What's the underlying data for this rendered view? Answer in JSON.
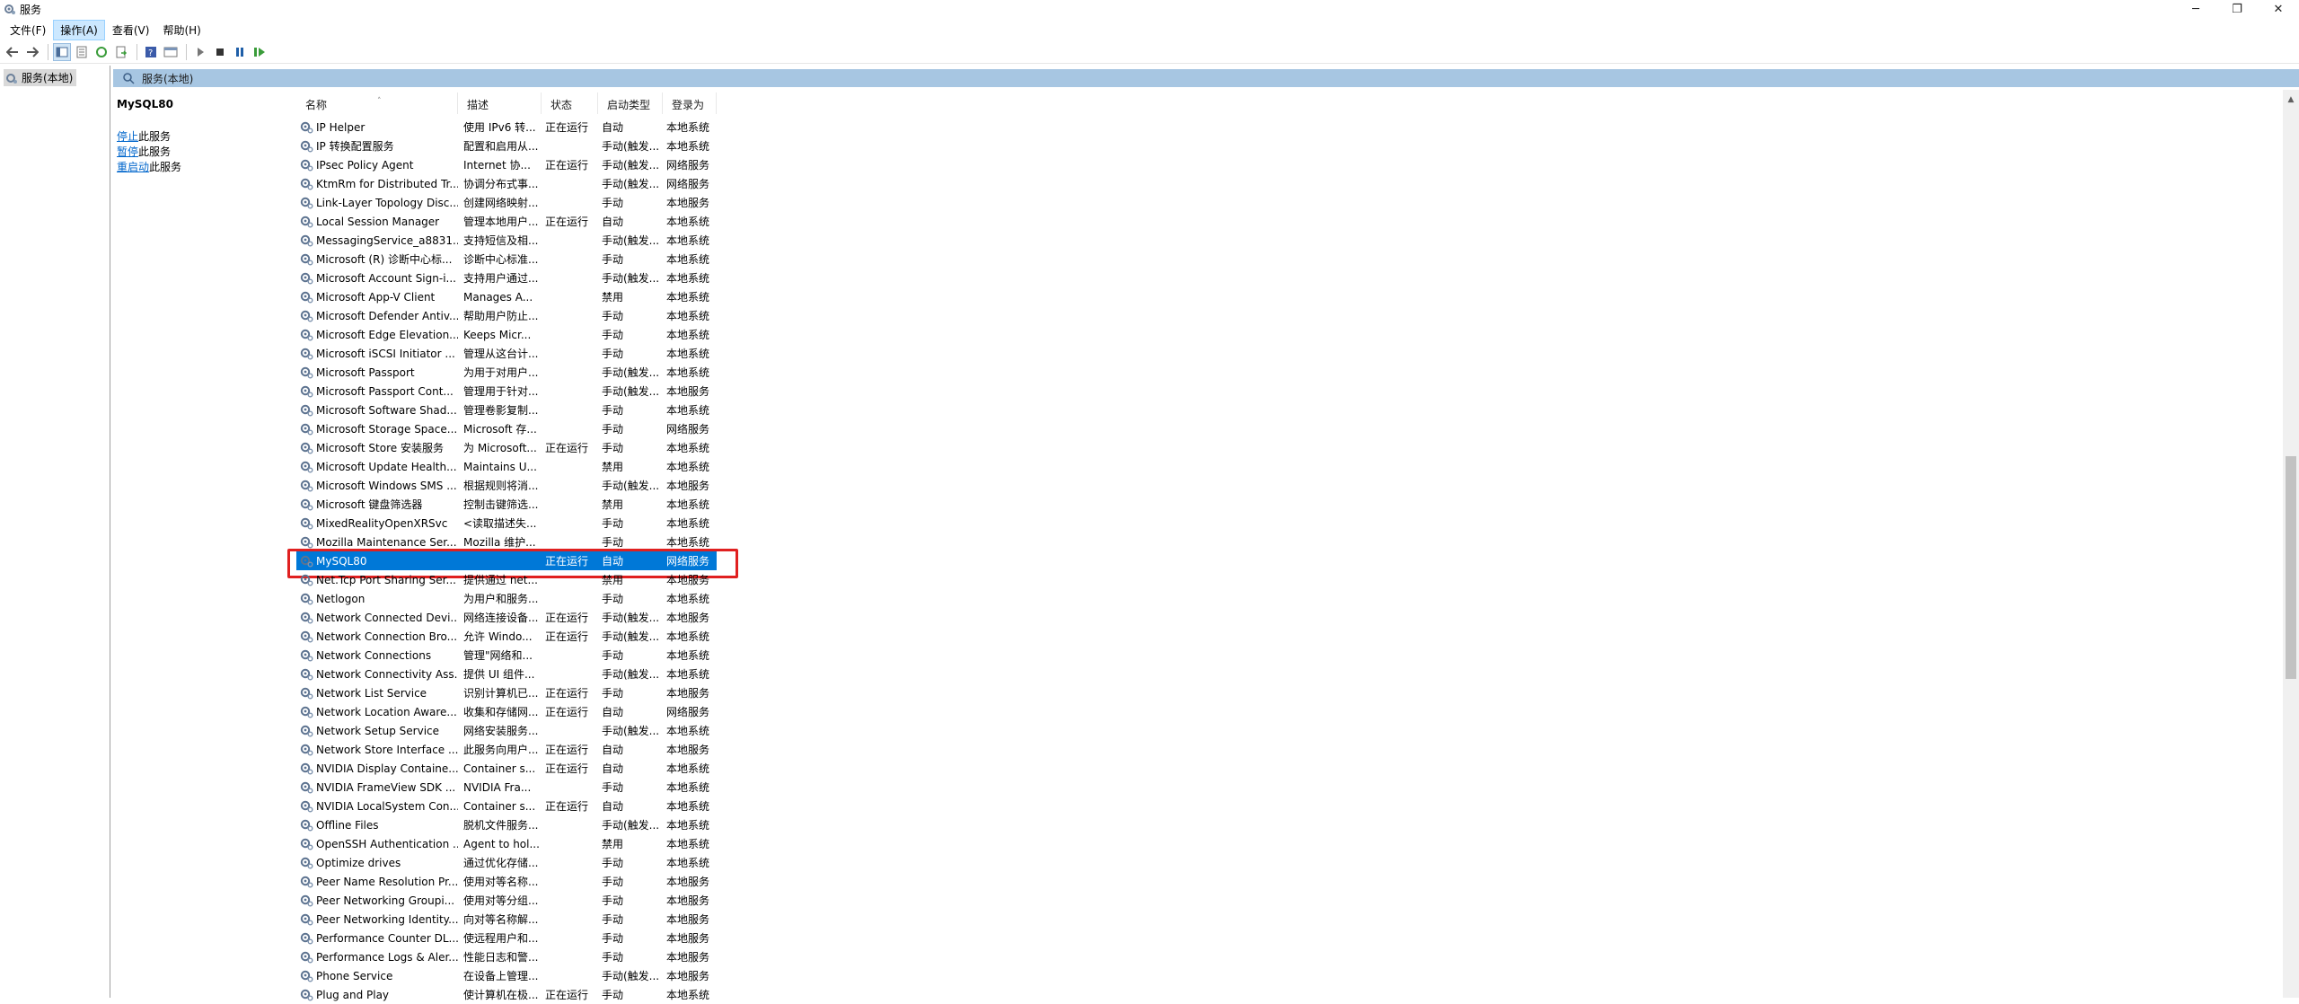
{
  "window": {
    "title": "服务"
  },
  "menu": [
    "文件(F)",
    "操作(A)",
    "查看(V)",
    "帮助(H)"
  ],
  "tree": {
    "root_label": "服务(本地)"
  },
  "pane": {
    "header_label": "服务(本地)"
  },
  "selected_service": {
    "name": "MySQL80",
    "stop_link": "停止",
    "stop_suffix": "此服务",
    "pause_link": "暂停",
    "pause_suffix": "此服务",
    "restart_link": "重启动",
    "restart_suffix": "此服务"
  },
  "columns": {
    "name": "名称",
    "description": "描述",
    "status": "状态",
    "startup": "启动类型",
    "logon": "登录为"
  },
  "rows": [
    {
      "name": "IP Helper",
      "desc": "使用 IPv6 转...",
      "status": "正在运行",
      "startup": "自动",
      "logon": "本地系统"
    },
    {
      "name": "IP 转换配置服务",
      "desc": "配置和启用从...",
      "status": "",
      "startup": "手动(触发...",
      "logon": "本地系统"
    },
    {
      "name": "IPsec Policy Agent",
      "desc": "Internet 协...",
      "status": "正在运行",
      "startup": "手动(触发...",
      "logon": "网络服务"
    },
    {
      "name": "KtmRm for Distributed Tr...",
      "desc": "协调分布式事...",
      "status": "",
      "startup": "手动(触发...",
      "logon": "网络服务"
    },
    {
      "name": "Link-Layer Topology Disc...",
      "desc": "创建网络映射...",
      "status": "",
      "startup": "手动",
      "logon": "本地服务"
    },
    {
      "name": "Local Session Manager",
      "desc": "管理本地用户...",
      "status": "正在运行",
      "startup": "自动",
      "logon": "本地系统"
    },
    {
      "name": "MessagingService_a8831...",
      "desc": "支持短信及相...",
      "status": "",
      "startup": "手动(触发...",
      "logon": "本地系统"
    },
    {
      "name": "Microsoft (R) 诊断中心标...",
      "desc": "诊断中心标准...",
      "status": "",
      "startup": "手动",
      "logon": "本地系统"
    },
    {
      "name": "Microsoft Account Sign-i...",
      "desc": "支持用户通过...",
      "status": "",
      "startup": "手动(触发...",
      "logon": "本地系统"
    },
    {
      "name": "Microsoft App-V Client",
      "desc": "Manages A...",
      "status": "",
      "startup": "禁用",
      "logon": "本地系统"
    },
    {
      "name": "Microsoft Defender Antiv...",
      "desc": "帮助用户防止...",
      "status": "",
      "startup": "手动",
      "logon": "本地系统"
    },
    {
      "name": "Microsoft Edge Elevation...",
      "desc": "Keeps Micr...",
      "status": "",
      "startup": "手动",
      "logon": "本地系统"
    },
    {
      "name": "Microsoft iSCSI Initiator ...",
      "desc": "管理从这台计...",
      "status": "",
      "startup": "手动",
      "logon": "本地系统"
    },
    {
      "name": "Microsoft Passport",
      "desc": "为用于对用户...",
      "status": "",
      "startup": "手动(触发...",
      "logon": "本地系统"
    },
    {
      "name": "Microsoft Passport Cont...",
      "desc": "管理用于针对...",
      "status": "",
      "startup": "手动(触发...",
      "logon": "本地服务"
    },
    {
      "name": "Microsoft Software Shad...",
      "desc": "管理卷影复制...",
      "status": "",
      "startup": "手动",
      "logon": "本地系统"
    },
    {
      "name": "Microsoft Storage Space...",
      "desc": "Microsoft 存...",
      "status": "",
      "startup": "手动",
      "logon": "网络服务"
    },
    {
      "name": "Microsoft Store 安装服务",
      "desc": "为 Microsoft...",
      "status": "正在运行",
      "startup": "手动",
      "logon": "本地系统"
    },
    {
      "name": "Microsoft Update Health...",
      "desc": "Maintains U...",
      "status": "",
      "startup": "禁用",
      "logon": "本地系统"
    },
    {
      "name": "Microsoft Windows SMS ...",
      "desc": "根据规则将消...",
      "status": "",
      "startup": "手动(触发...",
      "logon": "本地服务"
    },
    {
      "name": "Microsoft 键盘筛选器",
      "desc": "控制击键筛选...",
      "status": "",
      "startup": "禁用",
      "logon": "本地系统"
    },
    {
      "name": "MixedRealityOpenXRSvc",
      "desc": "<读取描述失...",
      "status": "",
      "startup": "手动",
      "logon": "本地系统"
    },
    {
      "name": "Mozilla Maintenance Ser...",
      "desc": "Mozilla 维护...",
      "status": "",
      "startup": "手动",
      "logon": "本地系统"
    },
    {
      "name": "MySQL80",
      "desc": "",
      "status": "正在运行",
      "startup": "自动",
      "logon": "网络服务",
      "selected": true
    },
    {
      "name": "Net.Tcp Port Sharing Ser...",
      "desc": "提供通过 net...",
      "status": "",
      "startup": "禁用",
      "logon": "本地服务"
    },
    {
      "name": "Netlogon",
      "desc": "为用户和服务...",
      "status": "",
      "startup": "手动",
      "logon": "本地系统"
    },
    {
      "name": "Network Connected Devi...",
      "desc": "网络连接设备...",
      "status": "正在运行",
      "startup": "手动(触发...",
      "logon": "本地服务"
    },
    {
      "name": "Network Connection Bro...",
      "desc": "允许 Windo...",
      "status": "正在运行",
      "startup": "手动(触发...",
      "logon": "本地系统"
    },
    {
      "name": "Network Connections",
      "desc": "管理\"网络和...",
      "status": "",
      "startup": "手动",
      "logon": "本地系统"
    },
    {
      "name": "Network Connectivity Ass...",
      "desc": "提供 UI 组件...",
      "status": "",
      "startup": "手动(触发...",
      "logon": "本地系统"
    },
    {
      "name": "Network List Service",
      "desc": "识别计算机已...",
      "status": "正在运行",
      "startup": "手动",
      "logon": "本地服务"
    },
    {
      "name": "Network Location Aware...",
      "desc": "收集和存储网...",
      "status": "正在运行",
      "startup": "自动",
      "logon": "网络服务"
    },
    {
      "name": "Network Setup Service",
      "desc": "网络安装服务...",
      "status": "",
      "startup": "手动(触发...",
      "logon": "本地系统"
    },
    {
      "name": "Network Store Interface ...",
      "desc": "此服务向用户...",
      "status": "正在运行",
      "startup": "自动",
      "logon": "本地服务"
    },
    {
      "name": "NVIDIA Display Containe...",
      "desc": "Container s...",
      "status": "正在运行",
      "startup": "自动",
      "logon": "本地系统"
    },
    {
      "name": "NVIDIA FrameView SDK ...",
      "desc": "NVIDIA Fra...",
      "status": "",
      "startup": "手动",
      "logon": "本地系统"
    },
    {
      "name": "NVIDIA LocalSystem Con...",
      "desc": "Container s...",
      "status": "正在运行",
      "startup": "自动",
      "logon": "本地系统"
    },
    {
      "name": "Offline Files",
      "desc": "脱机文件服务...",
      "status": "",
      "startup": "手动(触发...",
      "logon": "本地系统"
    },
    {
      "name": "OpenSSH Authentication ...",
      "desc": "Agent to hol...",
      "status": "",
      "startup": "禁用",
      "logon": "本地系统"
    },
    {
      "name": "Optimize drives",
      "desc": "通过优化存储...",
      "status": "",
      "startup": "手动",
      "logon": "本地系统"
    },
    {
      "name": "Peer Name Resolution Pr...",
      "desc": "使用对等名称...",
      "status": "",
      "startup": "手动",
      "logon": "本地服务"
    },
    {
      "name": "Peer Networking Groupi...",
      "desc": "使用对等分组...",
      "status": "",
      "startup": "手动",
      "logon": "本地服务"
    },
    {
      "name": "Peer Networking Identity...",
      "desc": "向对等名称解...",
      "status": "",
      "startup": "手动",
      "logon": "本地服务"
    },
    {
      "name": "Performance Counter DL...",
      "desc": "使远程用户和...",
      "status": "",
      "startup": "手动",
      "logon": "本地服务"
    },
    {
      "name": "Performance Logs & Aler...",
      "desc": "性能日志和警...",
      "status": "",
      "startup": "手动",
      "logon": "本地服务"
    },
    {
      "name": "Phone Service",
      "desc": "在设备上管理...",
      "status": "",
      "startup": "手动(触发...",
      "logon": "本地服务"
    },
    {
      "name": "Plug and Play",
      "desc": "使计算机在极...",
      "status": "正在运行",
      "startup": "手动",
      "logon": "本地系统"
    }
  ]
}
